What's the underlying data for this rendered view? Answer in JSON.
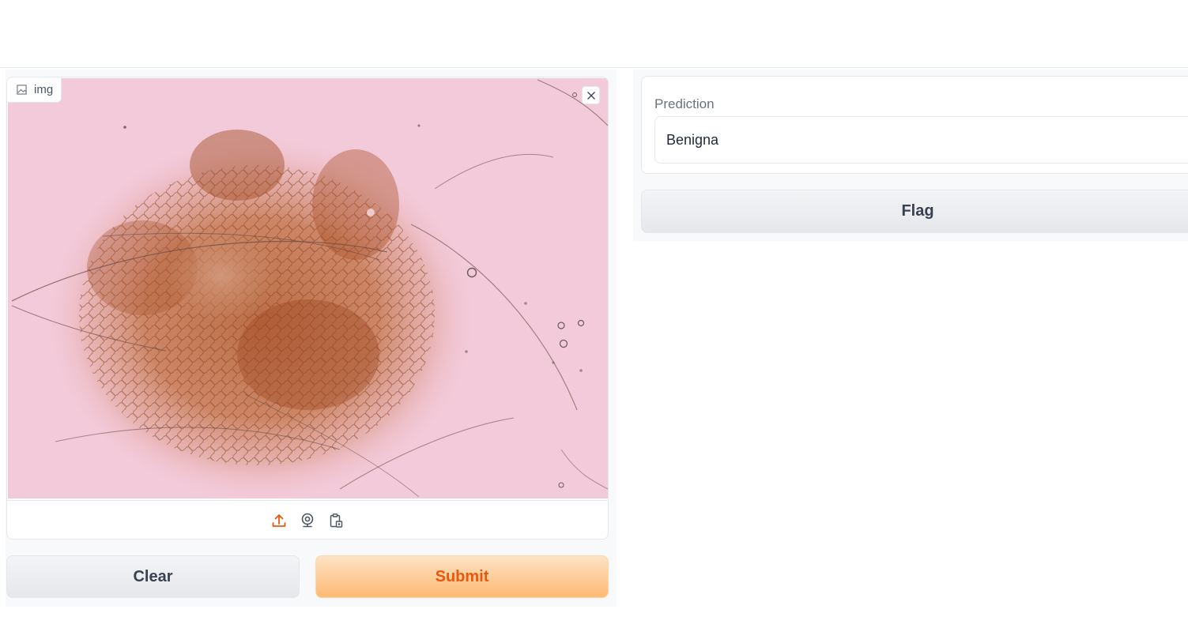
{
  "input": {
    "label": "img",
    "image_alt": "Dermoscopic image of pigmented skin lesion",
    "toolbar": {
      "upload_icon": "upload-icon",
      "webcam_icon": "webcam-icon",
      "clipboard_icon": "clipboard-icon"
    }
  },
  "buttons": {
    "clear": "Clear",
    "submit": "Submit",
    "flag": "Flag"
  },
  "output": {
    "label": "Prediction",
    "value": "Benigna"
  },
  "colors": {
    "accent": "#ea580c",
    "submit_gradient_end": "#fdba74",
    "skin": "#f3c6d6",
    "lesion": "#a7552a"
  }
}
